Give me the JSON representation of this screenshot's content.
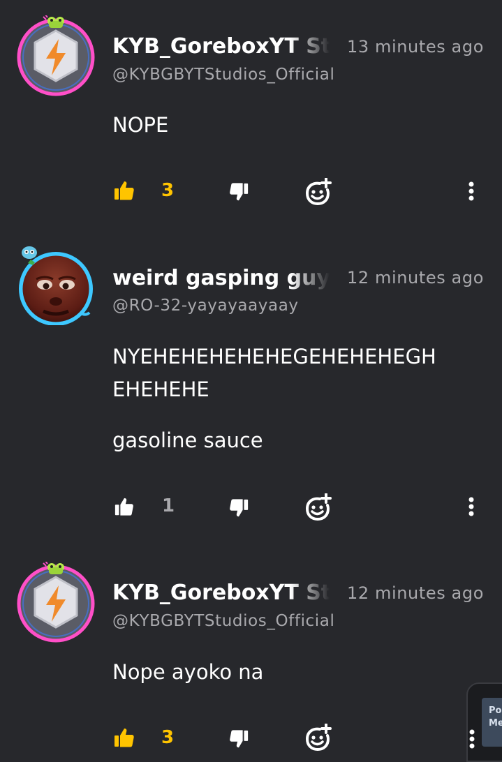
{
  "comments": [
    {
      "name": "KYB_GoreboxYT Studios",
      "handle": "@KYBGBYTStudios_Official",
      "time": "13 minutes ago",
      "paragraphs": [
        "NOPE"
      ],
      "likes": "3",
      "liked": true,
      "avatar_icon": "lightning-badge-icon"
    },
    {
      "name": "weird gasping guy.",
      "handle": "@RO-32-yayayaayaay",
      "time": "12 minutes ago",
      "paragraphs": [
        "NYEHEHEHEHEHEGEHEHEHEGH",
        "EHEHEHE",
        "gasoline sauce"
      ],
      "likes": "1",
      "liked": false,
      "avatar_icon": "face-photo-avatar"
    },
    {
      "name": "KYB_GoreboxYT Studios",
      "handle": "@KYBGBYTStudios_Official",
      "time": "12 minutes ago",
      "paragraphs": [
        "Nope ayoko na"
      ],
      "likes": "3",
      "liked": true,
      "avatar_icon": "lightning-badge-icon"
    }
  ],
  "popup": {
    "line1": "Pow",
    "line2": "Me"
  },
  "colors": {
    "background": "#27282c",
    "liked": "#ffc400",
    "muted": "#a9a9ad",
    "ring_pink": "#ff4fc8",
    "ring_blue": "#3ec8ff"
  }
}
